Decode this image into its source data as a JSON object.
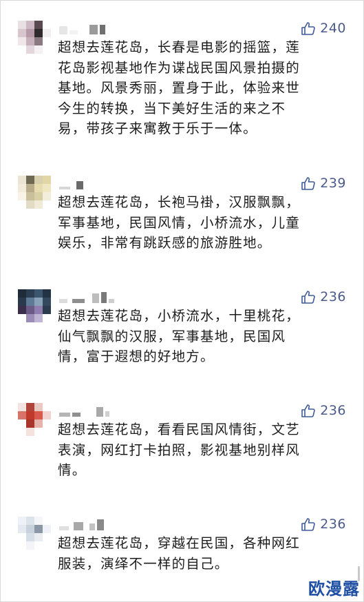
{
  "comments": [
    {
      "likes": "240",
      "lines": [
        "超想去莲花岛，长春是电影的摇篮，莲",
        "花岛影视基地作为谍战民国风景拍摄的",
        "基地。风景秀丽，置身于此，体验来世",
        "今生的转换，当下美好生活的来之不",
        "易，带孩子来寓教于乐于一体。"
      ]
    },
    {
      "likes": "239",
      "lines": [
        "超想去莲花岛，长袍马褂，汉服飘飘，",
        "军事基地，民国风情，小桥流水，儿童",
        "娱乐，非常有跳跃感的旅游胜地。"
      ]
    },
    {
      "likes": "236",
      "lines": [
        "超想去莲花岛，小桥流水，十里桃花，",
        "仙气飘飘的汉服，军事基地，民国风",
        "情，富于遐想的好地方。"
      ]
    },
    {
      "likes": "236",
      "lines": [
        "超想去莲花岛，看看民国风情街，文艺",
        "表演，网红打卡拍照，影视基地别样风",
        "情。"
      ]
    },
    {
      "likes": "236",
      "lines": [
        "超想去莲花岛，穿越在民国，各种网红",
        "服装，演绎不一样的自己。"
      ]
    }
  ],
  "icons": {
    "like": "thumbs-up-icon"
  },
  "watermark": "欧漫露",
  "colors": {
    "like": "#3d5a99",
    "watermark": "#1e4fa3",
    "text": "#1c1c1c"
  }
}
